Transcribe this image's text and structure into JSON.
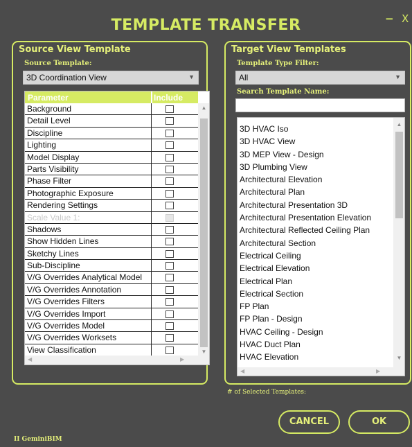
{
  "window": {
    "title": "TEMPLATE TRANSFER",
    "minimize_glyph": "−",
    "close_glyph": "X",
    "accent_color": "#d6eb63",
    "background_color": "#4b4b4b"
  },
  "source": {
    "group_title": "Source View Template",
    "template_label": "Source Template:",
    "template_value": "3D Coordination View",
    "table": {
      "col_parameter": "Parameter",
      "col_include": "Include",
      "rows": [
        {
          "name": "Background",
          "checked": false,
          "disabled": false
        },
        {
          "name": "Detail Level",
          "checked": false,
          "disabled": false
        },
        {
          "name": "Discipline",
          "checked": false,
          "disabled": false
        },
        {
          "name": "Lighting",
          "checked": false,
          "disabled": false
        },
        {
          "name": "Model Display",
          "checked": false,
          "disabled": false
        },
        {
          "name": "Parts Visibility",
          "checked": false,
          "disabled": false
        },
        {
          "name": "Phase Filter",
          "checked": false,
          "disabled": false
        },
        {
          "name": "Photographic Exposure",
          "checked": false,
          "disabled": false
        },
        {
          "name": "Rendering Settings",
          "checked": false,
          "disabled": false
        },
        {
          "name": "Scale Value    1:",
          "checked": false,
          "disabled": true
        },
        {
          "name": "Shadows",
          "checked": false,
          "disabled": false
        },
        {
          "name": "Show Hidden Lines",
          "checked": false,
          "disabled": false
        },
        {
          "name": "Sketchy Lines",
          "checked": false,
          "disabled": false
        },
        {
          "name": "Sub-Discipline",
          "checked": false,
          "disabled": false
        },
        {
          "name": "V/G Overrides Analytical Model",
          "checked": false,
          "disabled": false
        },
        {
          "name": "V/G Overrides Annotation",
          "checked": false,
          "disabled": false
        },
        {
          "name": "V/G Overrides Filters",
          "checked": false,
          "disabled": false
        },
        {
          "name": "V/G Overrides Import",
          "checked": false,
          "disabled": false
        },
        {
          "name": "V/G Overrides Model",
          "checked": false,
          "disabled": false
        },
        {
          "name": "V/G Overrides Worksets",
          "checked": false,
          "disabled": false
        },
        {
          "name": "View Classification",
          "checked": false,
          "disabled": false
        }
      ]
    }
  },
  "target": {
    "group_title": "Target View Templates",
    "filter_label": "Template Type Filter:",
    "filter_value": "All",
    "search_label": "Search Template Name:",
    "search_value": "",
    "templates": [
      "3D HVAC Iso",
      "3D HVAC View",
      "3D MEP View - Design",
      "3D Plumbing View",
      "Architectural Elevation",
      "Architectural Plan",
      "Architectural Presentation 3D",
      "Architectural Presentation Elevation",
      "Architectural Reflected Ceiling Plan",
      "Architectural Section",
      "Electrical Ceiling",
      "Electrical Elevation",
      "Electrical Plan",
      "Electrical Section",
      "FP Plan",
      "FP Plan - Design",
      "HVAC Ceiling - Design",
      "HVAC Duct Plan",
      "HVAC Elevation"
    ],
    "selected_count_label": "# of Selected Templates:"
  },
  "buttons": {
    "cancel": "CANCEL",
    "ok": "OK"
  },
  "brand": "II GeminiBIM",
  "icons": {
    "chevron": "chevron-down-icon",
    "scroll_up": "scroll-up-arrow-icon",
    "scroll_down": "scroll-down-arrow-icon"
  }
}
